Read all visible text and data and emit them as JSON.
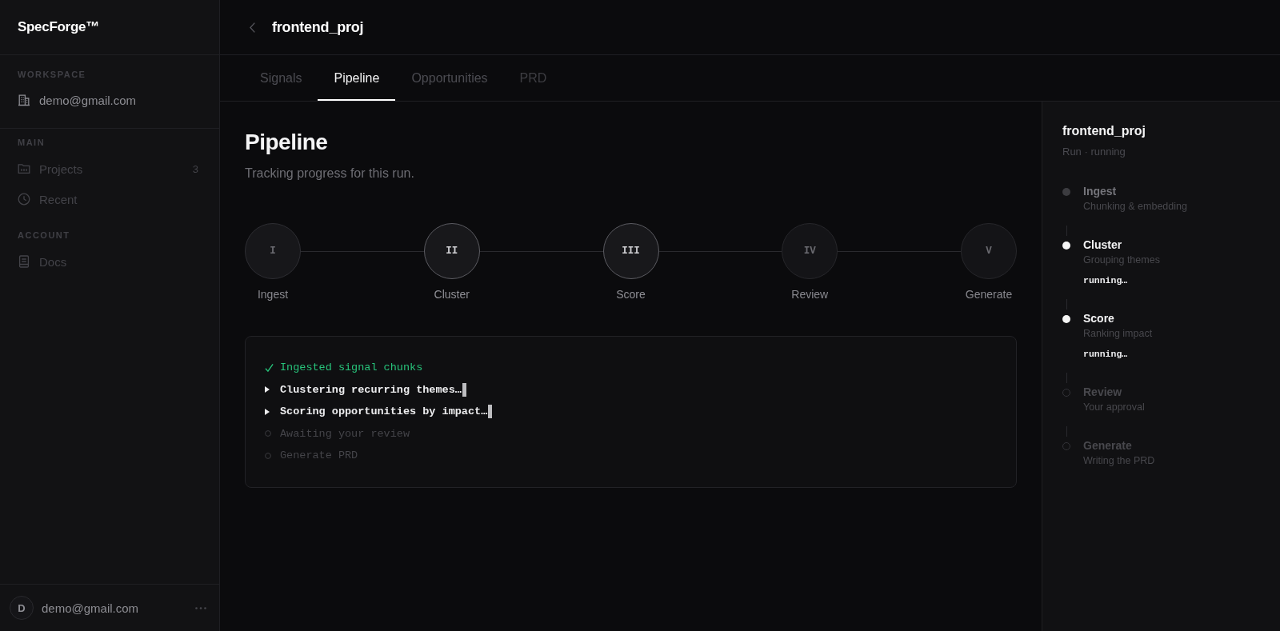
{
  "sidebar": {
    "logo": "SpecForge™",
    "workspace": {
      "label": "WORKSPACE",
      "name": "demo@gmail.com"
    },
    "nav_sections": [
      {
        "label": "MAIN",
        "items": [
          {
            "label": "Projects",
            "count": "3"
          },
          {
            "label": "Recent"
          }
        ]
      },
      {
        "label": "ACCOUNT",
        "items": [
          {
            "label": "Docs"
          }
        ]
      }
    ],
    "user": {
      "initial": "D",
      "email": "demo@gmail.com"
    }
  },
  "header": {
    "title": "frontend_proj"
  },
  "tabs": [
    {
      "label": "Signals",
      "selected": false,
      "disabled": false
    },
    {
      "label": "Pipeline",
      "selected": true,
      "disabled": false
    },
    {
      "label": "Opportunities",
      "selected": false,
      "disabled": false
    },
    {
      "label": "PRD",
      "selected": false,
      "disabled": true
    }
  ],
  "pipeline": {
    "title": "Pipeline",
    "subtitle": "Tracking progress for this run.",
    "steps": [
      {
        "numeral": "I",
        "label": "Ingest",
        "kind": "done"
      },
      {
        "numeral": "II",
        "label": "Cluster",
        "kind": "running"
      },
      {
        "numeral": "III",
        "label": "Score",
        "kind": "running"
      },
      {
        "numeral": "IV",
        "label": "Review",
        "kind": "pending"
      },
      {
        "numeral": "V",
        "label": "Generate",
        "kind": "pending"
      }
    ],
    "log": [
      {
        "kind": "done",
        "text": "Ingested signal chunks"
      },
      {
        "kind": "running",
        "text": "Clustering recurring themes…"
      },
      {
        "kind": "running",
        "text": "Scoring opportunities by impact…"
      },
      {
        "kind": "pending",
        "text": "Awaiting your review"
      },
      {
        "kind": "pending",
        "text": "Generate PRD"
      }
    ]
  },
  "run": {
    "title": "frontend_proj",
    "subtitle": "Run · running",
    "steps": [
      {
        "title": "Ingest",
        "description": "Chunking & embedding",
        "kind": "done"
      },
      {
        "title": "Cluster",
        "description": "Grouping themes",
        "kind": "running",
        "note": "running…"
      },
      {
        "title": "Score",
        "description": "Ranking impact",
        "kind": "running",
        "note": "running…"
      },
      {
        "title": "Review",
        "description": "Your approval",
        "kind": "pending"
      },
      {
        "title": "Generate",
        "description": "Writing the PRD",
        "kind": "pending"
      }
    ]
  }
}
